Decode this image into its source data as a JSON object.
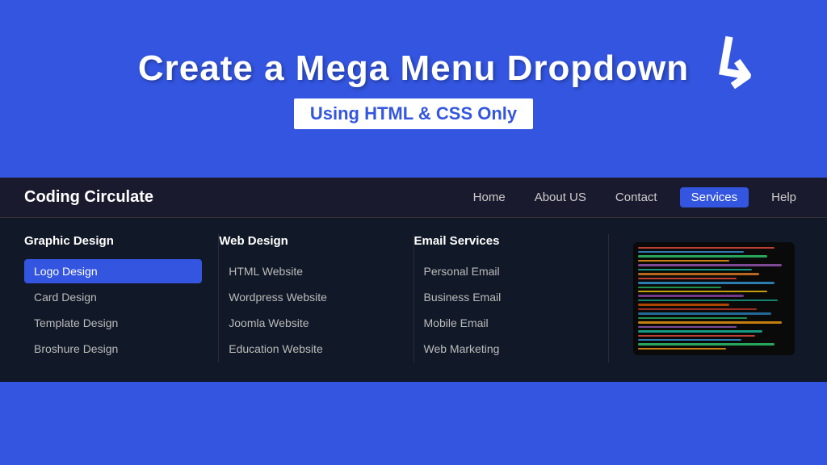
{
  "hero": {
    "title": "Create a Mega Menu Dropdown",
    "subtitle": "Using HTML & CSS Only"
  },
  "navbar": {
    "brand": "Coding Circulate",
    "nav_items": [
      {
        "label": "Home",
        "active": false
      },
      {
        "label": "About US",
        "active": false
      },
      {
        "label": "Contact",
        "active": false
      },
      {
        "label": "Services",
        "active": true
      },
      {
        "label": "Help",
        "active": false
      }
    ]
  },
  "megamenu": {
    "columns": [
      {
        "header": "Graphic Design",
        "items": [
          "Logo Design",
          "Card Design",
          "Template Design",
          "Broshure Design"
        ],
        "highlighted": 0
      },
      {
        "header": "Web Design",
        "items": [
          "HTML Website",
          "Wordpress Website",
          "Joomla Website",
          "Education Website"
        ],
        "highlighted": -1
      },
      {
        "header": "Email Services",
        "items": [
          "Personal Email",
          "Business Email",
          "Mobile Email",
          "Web Marketing"
        ],
        "highlighted": -1
      }
    ]
  },
  "colors": {
    "accent": "#3355e0",
    "dark_bg": "#111827",
    "navbar_bg": "#1a1a2e"
  }
}
